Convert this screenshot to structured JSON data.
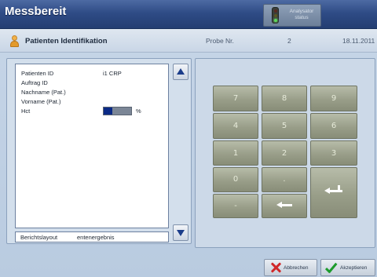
{
  "app": {
    "title": "Messbereit"
  },
  "instrument_status": {
    "label_line1": "Analysator",
    "label_line2": "status",
    "icon": "traffic-light-icon",
    "active_light": "green"
  },
  "info_bar": {
    "title": "Patienten Identifikation",
    "probe_label": "Probe Nr.",
    "probe_number": "2",
    "date": "18.11.2011",
    "icon": "patient-icon"
  },
  "form": {
    "fields": [
      {
        "label": "Patienten ID",
        "value": "i1 CRP"
      },
      {
        "label": "Auftrag ID",
        "value": ""
      },
      {
        "label": "Nachname (Pat.)",
        "value": ""
      },
      {
        "label": "Vorname (Pat.)",
        "value": ""
      },
      {
        "label": "Hct",
        "value": "",
        "unit": "%"
      }
    ],
    "report": {
      "label": "Berichtslayout",
      "value": "entenergebnis"
    }
  },
  "keypad": {
    "keys": [
      "7",
      "8",
      "9",
      "4",
      "5",
      "6",
      "1",
      "2",
      "3",
      "0",
      ".",
      "-"
    ],
    "backspace_icon": "backspace-arrow-icon",
    "enter_icon": "enter-return-icon"
  },
  "actions": {
    "cancel_label": "Abbrechen",
    "accept_label": "Akzeptieren"
  },
  "colors": {
    "title_bar": "#2f4c86",
    "key_face": "#999e89",
    "cancel": "#d0282a",
    "accept": "#1c9b2c"
  }
}
